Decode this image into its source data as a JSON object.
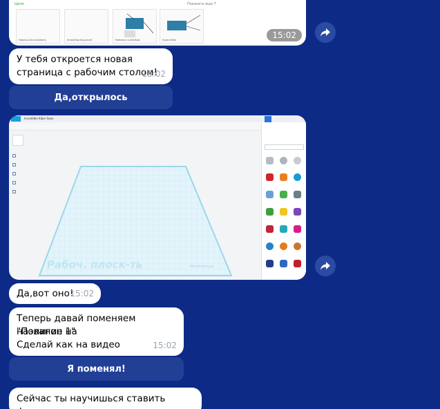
{
  "messages": {
    "top_image": {
      "time": "15:02",
      "header": "Цепи",
      "more_link": "Показать еще 7",
      "thumbnails": [
        "Fabulous Duel-Ashbirls",
        "Smashing Ikup-Jinert",
        "Nebulous Luhdi-Bojo",
        "Super-Kiber"
      ]
    },
    "bot1": {
      "text": "У тебя откроется новая страница с рабочим столом!",
      "time": "15:02"
    },
    "btn1": {
      "label": "Да,открылось"
    },
    "screenshot": {
      "app_title": "Incredible Kiber Sean",
      "plane_label": "Рабоч. плоск-ть",
      "units_label": "Миллиметры"
    },
    "bot2": {
      "text": "Да,вот оно!",
      "time": "15:02"
    },
    "bot3": {
      "lines": [
        "Теперь давай поменяем название на",
        "\"Полигон 1\"",
        "Сделай как на видео"
      ],
      "time": "15:02"
    },
    "btn2": {
      "label": "Я поменял!"
    },
    "bot4": {
      "text": "Сейчас ты научишься ставить фигуры на"
    }
  },
  "colors": {
    "background": "#0d2b86",
    "button": "#223f96",
    "bubble": "#ffffff"
  }
}
